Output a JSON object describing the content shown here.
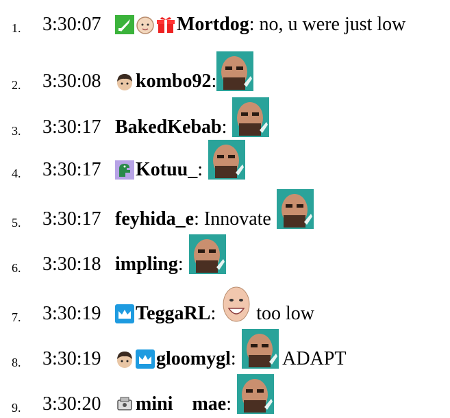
{
  "messages": [
    {
      "n": "1.",
      "time": "3:30:07",
      "user": "Mortdog",
      "sep": ":",
      "text": " no, u were just low",
      "badges": [
        "sword-badge-icon",
        "baby-face-badge-icon",
        "gift-badge-icon"
      ],
      "emotes": []
    },
    {
      "n": "2.",
      "time": "3:30:08",
      "user": "kombo92",
      "sep": ":",
      "text": "",
      "badges": [
        "dark-hair-badge-icon"
      ],
      "emotes": [
        "bearded-face-emote"
      ]
    },
    {
      "n": "3.",
      "time": "3:30:17",
      "user": "BakedKebab",
      "sep": ":",
      "text": "",
      "badges": [],
      "emotes": [
        "bearded-face-emote"
      ]
    },
    {
      "n": "4.",
      "time": "3:30:17",
      "user": "Kotuu_",
      "sep": ":",
      "text": "",
      "badges": [
        "dino-badge-icon"
      ],
      "emotes": [
        "bearded-face-emote"
      ]
    },
    {
      "n": "5.",
      "time": "3:30:17",
      "user": "feyhida_e",
      "sep": ":",
      "text": " Innovate",
      "badges": [],
      "emotes": [
        "bearded-face-emote"
      ]
    },
    {
      "n": "6.",
      "time": "3:30:18",
      "user": "impling",
      "sep": ":",
      "text": "",
      "badges": [],
      "emotes": [
        "bearded-face-emote"
      ]
    },
    {
      "n": "7.",
      "time": "3:30:19",
      "user": "TeggaRL",
      "sep": ":",
      "text": " too low",
      "badges": [
        "crown-badge-icon"
      ],
      "emotes": [
        "smiling-bald-face-emote"
      ]
    },
    {
      "n": "8.",
      "time": "3:30:19",
      "user": "gloomygl",
      "sep": ":",
      "text": " ADAPT",
      "badges": [
        "dark-hair-badge-icon",
        "crown-badge-icon"
      ],
      "emotes": [
        "bearded-face-emote"
      ]
    },
    {
      "n": "9.",
      "time": "3:30:20",
      "user": "mini    mae",
      "sep": ":",
      "text": "",
      "badges": [
        "gadget-badge-icon"
      ],
      "emotes": [
        "bearded-face-emote"
      ]
    }
  ]
}
